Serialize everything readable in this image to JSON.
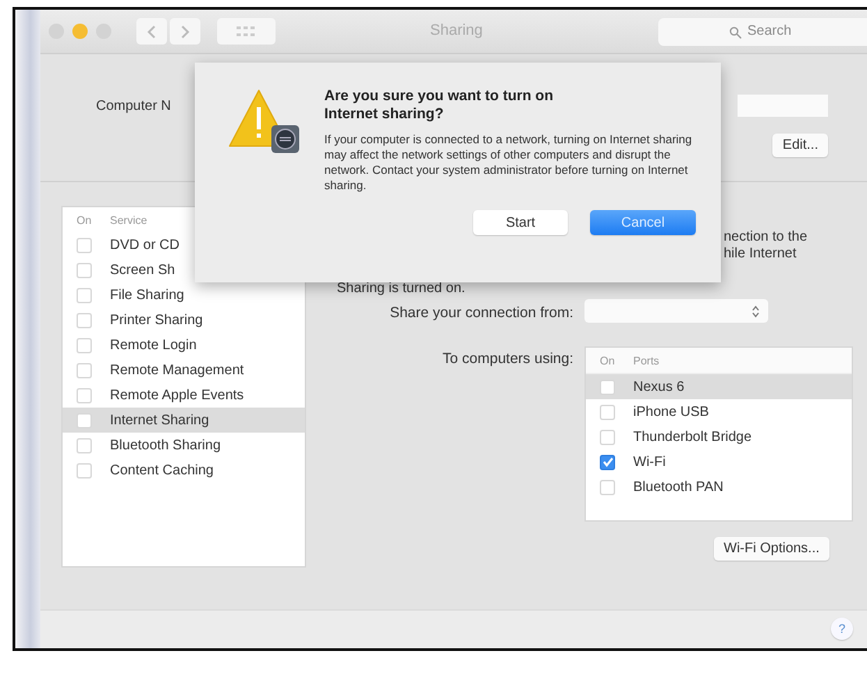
{
  "window": {
    "title": "Sharing",
    "search": {
      "placeholder": "Search"
    }
  },
  "computer_name": {
    "label": "Computer N",
    "edit_button": "Edit..."
  },
  "services": {
    "columns": [
      "On",
      "Service"
    ],
    "rows": [
      {
        "name": "DVD or CD",
        "checked": false,
        "selected": false
      },
      {
        "name": "Screen Sh",
        "checked": false,
        "selected": false
      },
      {
        "name": "File Sharing",
        "checked": false,
        "selected": false
      },
      {
        "name": "Printer Sharing",
        "checked": false,
        "selected": false
      },
      {
        "name": "Remote Login",
        "checked": false,
        "selected": false
      },
      {
        "name": "Remote Management",
        "checked": false,
        "selected": false
      },
      {
        "name": "Remote Apple Events",
        "checked": false,
        "selected": false
      },
      {
        "name": "Internet Sharing",
        "checked": false,
        "selected": true
      },
      {
        "name": "Bluetooth Sharing",
        "checked": false,
        "selected": false
      },
      {
        "name": "Content Caching",
        "checked": false,
        "selected": false
      }
    ]
  },
  "description": {
    "lines": [
      "nection to the",
      "hile Internet"
    ],
    "last_line": "Sharing is turned on."
  },
  "share_from": {
    "label": "Share your connection from:"
  },
  "to_computers": {
    "label": "To computers using:",
    "columns": [
      "On",
      "Ports"
    ],
    "rows": [
      {
        "name": "Nexus 6",
        "checked": false,
        "selected": true
      },
      {
        "name": "iPhone USB",
        "checked": false,
        "selected": false
      },
      {
        "name": "Thunderbolt Bridge",
        "checked": false,
        "selected": false
      },
      {
        "name": "Wi-Fi",
        "checked": true,
        "selected": false
      },
      {
        "name": "Bluetooth PAN",
        "checked": false,
        "selected": false
      }
    ]
  },
  "wifi_options_button": "Wi-Fi Options...",
  "help_button": "?",
  "dialog": {
    "title": "Are you sure you want to turn on Internet sharing?",
    "message": "If your computer is connected to a network, turning on Internet sharing may affect the network settings of other computers and disrupt the network. Contact your system administrator before turning on Internet sharing.",
    "buttons": [
      {
        "label": "Start",
        "default": false
      },
      {
        "label": "Cancel",
        "default": true
      }
    ]
  }
}
